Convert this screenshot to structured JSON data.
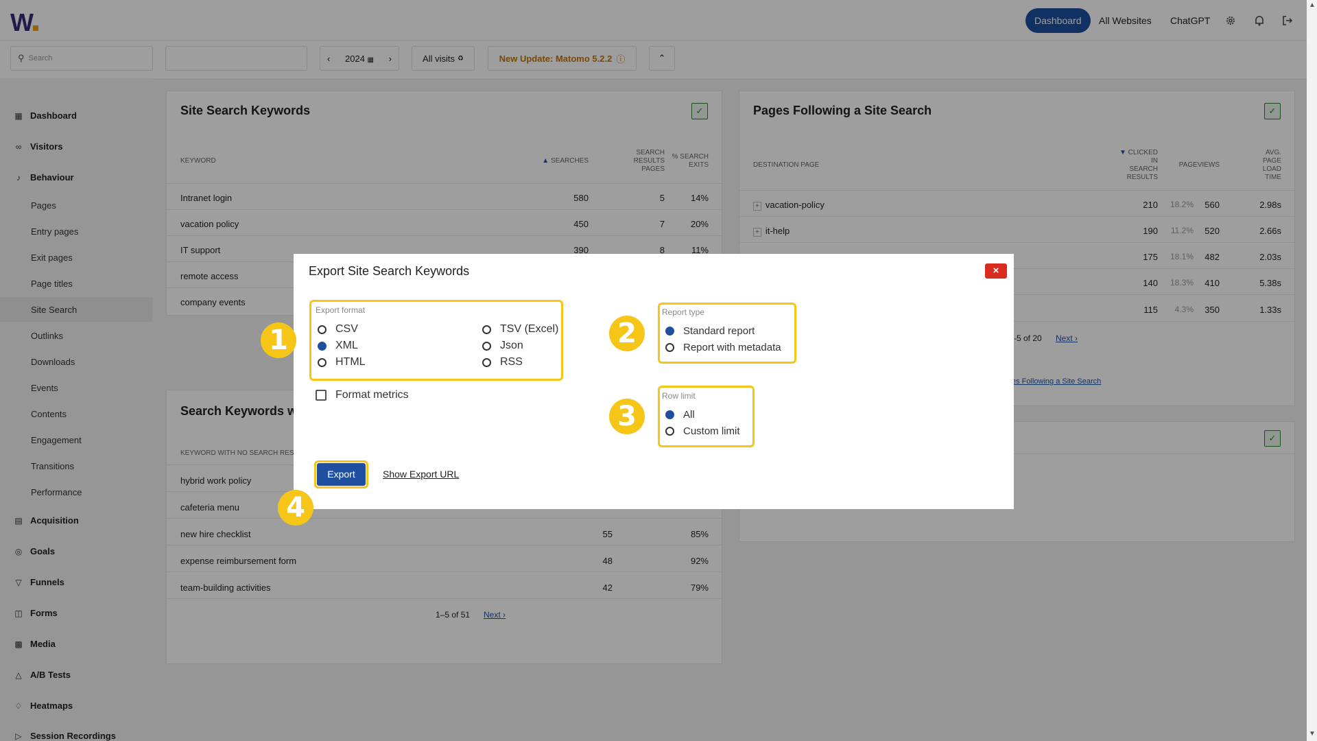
{
  "logo": {
    "text": "W"
  },
  "topnav": {
    "dashboard": "Dashboard",
    "all_websites": "All Websites",
    "chatgpt": "ChatGPT",
    "icons": [
      "gear-icon",
      "bell-icon",
      "logout-icon"
    ]
  },
  "controls": {
    "search_placeholder": "Search",
    "period": "2024",
    "segment": "All visits",
    "update_notice": "New Update: Matomo 5.2.2"
  },
  "sidebar": {
    "main": [
      {
        "label": "Dashboard",
        "icon": "grid-icon"
      },
      {
        "label": "Visitors",
        "icon": "binoculars-icon"
      },
      {
        "label": "Behaviour",
        "icon": "bell-icon"
      },
      {
        "label": "Acquisition",
        "icon": "acquisition-icon"
      },
      {
        "label": "Goals",
        "icon": "target-icon"
      },
      {
        "label": "Funnels",
        "icon": "funnel-icon"
      },
      {
        "label": "Forms",
        "icon": "clipboard-icon"
      },
      {
        "label": "Media",
        "icon": "media-icon"
      },
      {
        "label": "A/B Tests",
        "icon": "flask-icon"
      },
      {
        "label": "Heatmaps",
        "icon": "heatmap-icon"
      },
      {
        "label": "Session Recordings",
        "icon": "play-icon"
      }
    ],
    "behaviour_sub": [
      "Pages",
      "Entry pages",
      "Exit pages",
      "Page titles",
      "Site Search",
      "Outlinks",
      "Downloads",
      "Events",
      "Contents",
      "Engagement",
      "Transitions",
      "Performance"
    ],
    "active": "Site Search"
  },
  "site_search_keywords": {
    "title": "Site Search Keywords",
    "headers": {
      "keyword": "KEYWORD",
      "searches": "SEARCHES",
      "results_pages": [
        "SEARCH",
        "RESULTS",
        "PAGES"
      ],
      "exits": [
        "% SEARCH",
        "EXITS"
      ]
    },
    "rows": [
      {
        "keyword": "Intranet login",
        "searches": "580",
        "pages": "5",
        "exits": "14%"
      },
      {
        "keyword": "vacation policy",
        "searches": "450",
        "pages": "7",
        "exits": "20%"
      },
      {
        "keyword": "IT support",
        "searches": "390",
        "pages": "8",
        "exits": "11%"
      },
      {
        "keyword": "remote access",
        "searches": "",
        "pages": "",
        "exits": ""
      },
      {
        "keyword": "company events",
        "searches": "",
        "pages": "",
        "exits": ""
      }
    ]
  },
  "no_results": {
    "title": "Search Keywords wit",
    "header": "KEYWORD WITH NO SEARCH RES",
    "rows": [
      {
        "keyword": "hybrid work policy",
        "searches": "",
        "exits": ""
      },
      {
        "keyword": "cafeteria menu",
        "searches": "",
        "exits": ""
      },
      {
        "keyword": "new hire checklist",
        "searches": "55",
        "exits": "85%"
      },
      {
        "keyword": "expense reimbursement form",
        "searches": "48",
        "exits": "92%"
      },
      {
        "keyword": "team-building activities",
        "searches": "42",
        "exits": "79%"
      }
    ],
    "pagination": "1–5 of 51",
    "next": "Next ›"
  },
  "pages_following": {
    "title": "Pages Following a Site Search",
    "headers": {
      "destination": "DESTINATION PAGE",
      "clicked": [
        "CLICKED",
        "IN",
        "SEARCH",
        "RESULTS"
      ],
      "pageviews": "PAGEVIEWS",
      "load": [
        "AVG.",
        "PAGE",
        "LOAD",
        "TIME"
      ]
    },
    "rows": [
      {
        "page": "vacation-policy",
        "clicked": "210",
        "pct": "18.2%",
        "pageviews": "560",
        "load": "2.98s"
      },
      {
        "page": "it-help",
        "clicked": "190",
        "pct": "11.2%",
        "pageviews": "520",
        "load": "2.66s"
      },
      {
        "page": "",
        "clicked": "175",
        "pct": "18.1%",
        "pageviews": "482",
        "load": "2.03s"
      },
      {
        "page": "",
        "clicked": "140",
        "pct": "18.3%",
        "pageviews": "410",
        "load": "5.38s"
      },
      {
        "page": "",
        "clicked": "115",
        "pct": "4.3%",
        "pageviews": "350",
        "load": "1.33s"
      }
    ],
    "pagination": "-5 of 20",
    "next": "Next ›",
    "related_link": "es Following a Site Search"
  },
  "modal": {
    "title": "Export Site Search Keywords",
    "close": "×",
    "export_format": {
      "label": "Export format",
      "options": [
        "CSV",
        "XML",
        "HTML",
        "TSV (Excel)",
        "Json",
        "RSS"
      ],
      "selected": "XML"
    },
    "format_metrics": "Format metrics",
    "report_type": {
      "label": "Report type",
      "options": [
        "Standard report",
        "Report with metadata"
      ],
      "selected": "Standard report"
    },
    "row_limit": {
      "label": "Row limit",
      "options": [
        "All",
        "Custom limit"
      ],
      "selected": "All"
    },
    "export_button": "Export",
    "show_url": "Show Export URL"
  },
  "step_badges": [
    "1",
    "2",
    "3",
    "4"
  ],
  "colors": {
    "brand": "#1e4fa0",
    "highlight": "#f5c518",
    "close": "#d92c20",
    "update": "#c77700"
  }
}
